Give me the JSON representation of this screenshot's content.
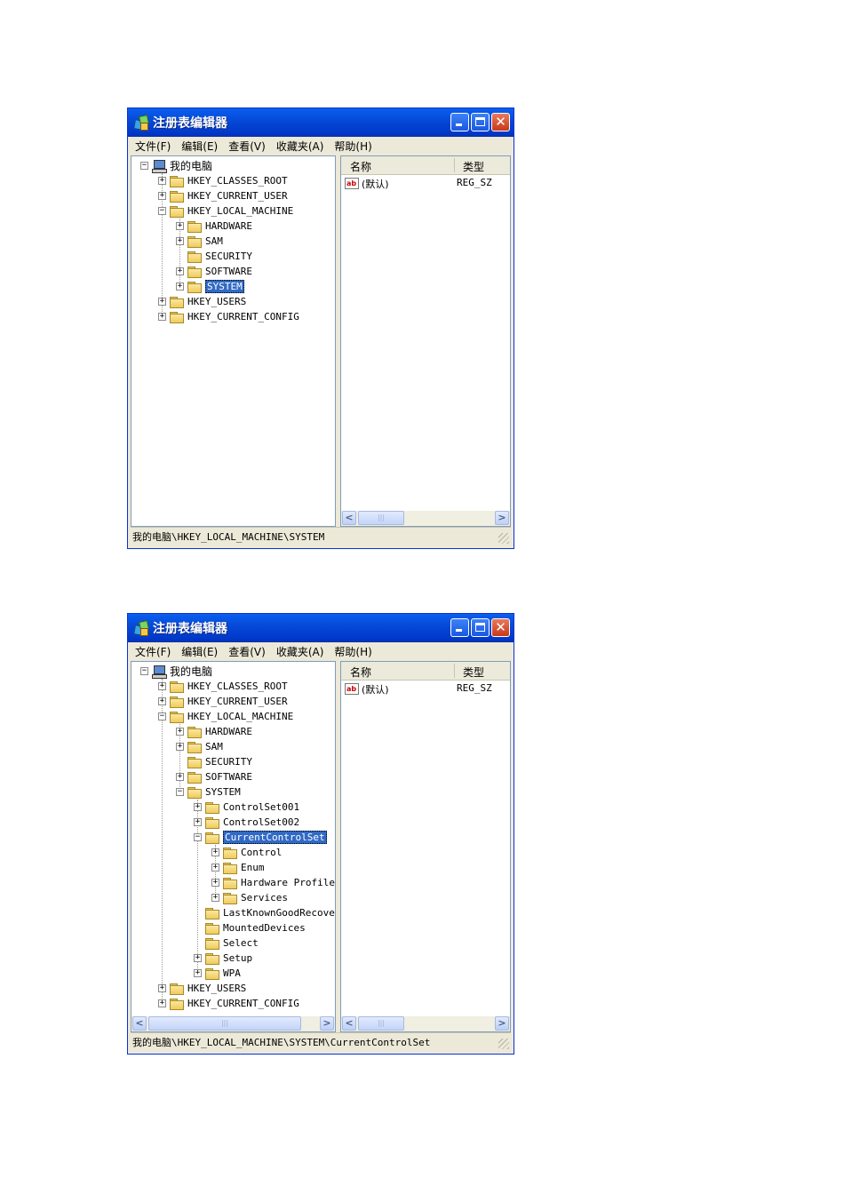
{
  "windows": [
    {
      "title": "注册表编辑器",
      "menu": [
        "文件(F)",
        "编辑(E)",
        "查看(V)",
        "收藏夹(A)",
        "帮助(H)"
      ],
      "tree": [
        {
          "label": "我的电脑",
          "level": 0,
          "exp": "-",
          "icon": "computer-icon"
        },
        {
          "label": "HKEY_CLASSES_ROOT",
          "level": 1,
          "exp": "+",
          "icon": "folder-icon"
        },
        {
          "label": "HKEY_CURRENT_USER",
          "level": 1,
          "exp": "+",
          "icon": "folder-icon"
        },
        {
          "label": "HKEY_LOCAL_MACHINE",
          "level": 1,
          "exp": "-",
          "icon": "folder-icon"
        },
        {
          "label": "HARDWARE",
          "level": 2,
          "exp": "+",
          "icon": "folder-icon"
        },
        {
          "label": "SAM",
          "level": 2,
          "exp": "+",
          "icon": "folder-icon"
        },
        {
          "label": "SECURITY",
          "level": 2,
          "exp": "",
          "icon": "folder-icon"
        },
        {
          "label": "SOFTWARE",
          "level": 2,
          "exp": "+",
          "icon": "folder-icon"
        },
        {
          "label": "SYSTEM",
          "level": 2,
          "exp": "+",
          "icon": "open-folder-icon",
          "selected": true
        },
        {
          "label": "HKEY_USERS",
          "level": 1,
          "exp": "+",
          "icon": "folder-icon"
        },
        {
          "label": "HKEY_CURRENT_CONFIG",
          "level": 1,
          "exp": "+",
          "icon": "folder-icon"
        }
      ],
      "list": {
        "columns": [
          "名称",
          "类型"
        ],
        "rows": [
          {
            "name": "(默认)",
            "type": "REG_SZ",
            "icon": "string-value-icon"
          }
        ]
      },
      "status": "我的电脑\\HKEY_LOCAL_MACHINE\\SYSTEM"
    },
    {
      "title": "注册表编辑器",
      "menu": [
        "文件(F)",
        "编辑(E)",
        "查看(V)",
        "收藏夹(A)",
        "帮助(H)"
      ],
      "tree": [
        {
          "label": "我的电脑",
          "level": 0,
          "exp": "-",
          "icon": "computer-icon"
        },
        {
          "label": "HKEY_CLASSES_ROOT",
          "level": 1,
          "exp": "+",
          "icon": "folder-icon"
        },
        {
          "label": "HKEY_CURRENT_USER",
          "level": 1,
          "exp": "+",
          "icon": "folder-icon"
        },
        {
          "label": "HKEY_LOCAL_MACHINE",
          "level": 1,
          "exp": "-",
          "icon": "folder-icon"
        },
        {
          "label": "HARDWARE",
          "level": 2,
          "exp": "+",
          "icon": "folder-icon"
        },
        {
          "label": "SAM",
          "level": 2,
          "exp": "+",
          "icon": "folder-icon"
        },
        {
          "label": "SECURITY",
          "level": 2,
          "exp": "",
          "icon": "folder-icon"
        },
        {
          "label": "SOFTWARE",
          "level": 2,
          "exp": "+",
          "icon": "folder-icon"
        },
        {
          "label": "SYSTEM",
          "level": 2,
          "exp": "-",
          "icon": "folder-icon"
        },
        {
          "label": "ControlSet001",
          "level": 3,
          "exp": "+",
          "icon": "folder-icon"
        },
        {
          "label": "ControlSet002",
          "level": 3,
          "exp": "+",
          "icon": "folder-icon"
        },
        {
          "label": "CurrentControlSet",
          "level": 3,
          "exp": "-",
          "icon": "open-folder-icon",
          "selected": true
        },
        {
          "label": "Control",
          "level": 4,
          "exp": "+",
          "icon": "folder-icon"
        },
        {
          "label": "Enum",
          "level": 4,
          "exp": "+",
          "icon": "folder-icon"
        },
        {
          "label": "Hardware Profiles",
          "level": 4,
          "exp": "+",
          "icon": "folder-icon"
        },
        {
          "label": "Services",
          "level": 4,
          "exp": "+",
          "icon": "folder-icon"
        },
        {
          "label": "LastKnownGoodRecovery",
          "level": 3,
          "exp": "",
          "icon": "folder-icon"
        },
        {
          "label": "MountedDevices",
          "level": 3,
          "exp": "",
          "icon": "folder-icon"
        },
        {
          "label": "Select",
          "level": 3,
          "exp": "",
          "icon": "folder-icon"
        },
        {
          "label": "Setup",
          "level": 3,
          "exp": "+",
          "icon": "folder-icon"
        },
        {
          "label": "WPA",
          "level": 3,
          "exp": "+",
          "icon": "folder-icon"
        },
        {
          "label": "HKEY_USERS",
          "level": 1,
          "exp": "+",
          "icon": "folder-icon"
        },
        {
          "label": "HKEY_CURRENT_CONFIG",
          "level": 1,
          "exp": "+",
          "icon": "folder-icon"
        }
      ],
      "list": {
        "columns": [
          "名称",
          "类型"
        ],
        "rows": [
          {
            "name": "(默认)",
            "type": "REG_SZ",
            "icon": "string-value-icon"
          }
        ]
      },
      "status": "我的电脑\\HKEY_LOCAL_MACHINE\\SYSTEM\\CurrentControlSet"
    }
  ]
}
